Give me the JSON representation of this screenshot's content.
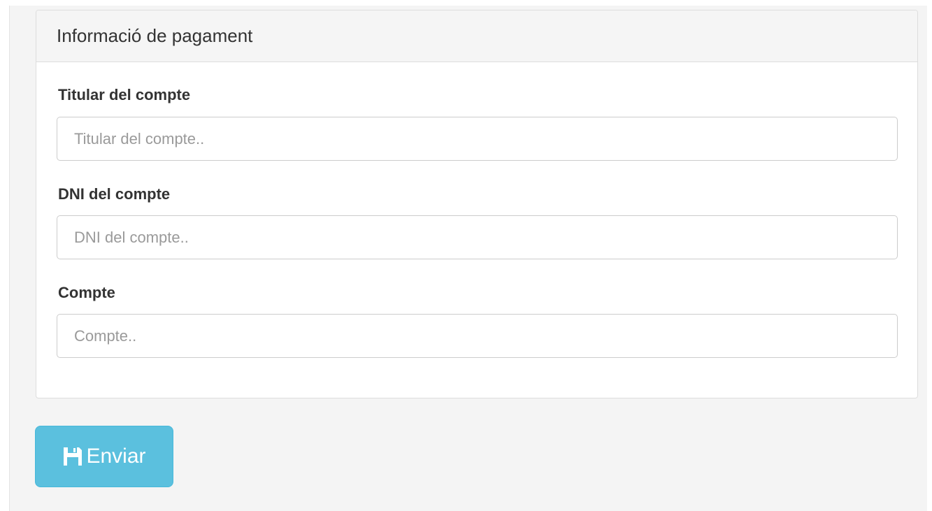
{
  "panel": {
    "title": "Informació de pagament"
  },
  "form": {
    "fields": [
      {
        "label": "Titular del compte",
        "placeholder": "Titular del compte..",
        "value": ""
      },
      {
        "label": "DNI del compte",
        "placeholder": "DNI del compte..",
        "value": ""
      },
      {
        "label": "Compte",
        "placeholder": "Compte..",
        "value": ""
      }
    ]
  },
  "submit": {
    "label": "Enviar",
    "icon": "save-icon"
  },
  "colors": {
    "button": "#5bc0de",
    "page_background": "#f4f4f4",
    "panel_heading": "#f5f5f5"
  }
}
